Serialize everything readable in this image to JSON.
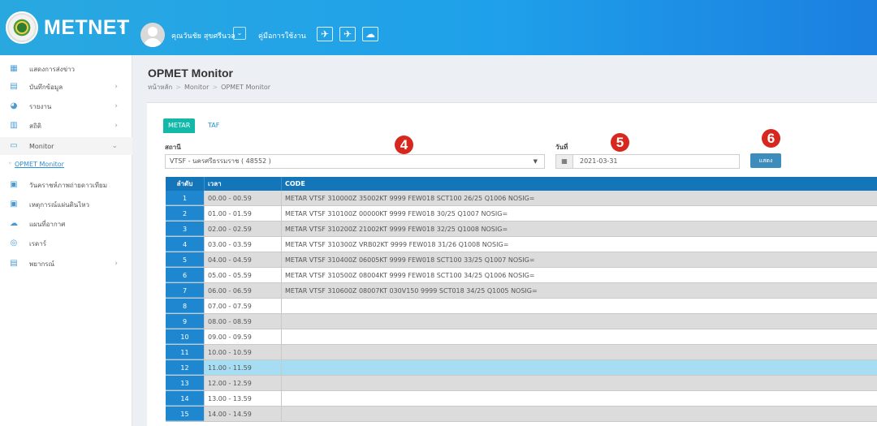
{
  "header": {
    "brand": "METNET",
    "collapse_icon": "chevron-left-icon",
    "username": "คุณวันชัย สุขศรีนวล",
    "user_caret": "⌄",
    "manual_link": "คู่มือการใช้งาน",
    "icons": [
      "plane-icon",
      "plane-icon",
      "cloud-icon"
    ]
  },
  "sidebar": {
    "items": [
      {
        "label": "แสดงการส่งข่าว",
        "icon": "grid-icon",
        "chevron": ""
      },
      {
        "label": "บันทึกข้อมูล",
        "icon": "document-icon",
        "chevron": "›"
      },
      {
        "label": "รายงาน",
        "icon": "pie-chart-icon",
        "chevron": "›"
      },
      {
        "label": "สถิติ",
        "icon": "bar-chart-icon",
        "chevron": "›"
      },
      {
        "label": "Monitor",
        "icon": "monitor-icon",
        "chevron": "⌄"
      },
      {
        "label": "วันคราชห์ภาพถ่ายดาวเทียม",
        "icon": "image-icon",
        "chevron": ""
      },
      {
        "label": "เหตุการณ์แผ่นดินไหว",
        "icon": "image-icon",
        "chevron": ""
      },
      {
        "label": "แผนที่อากาศ",
        "icon": "cloud-icon",
        "chevron": ""
      },
      {
        "label": "เรดาร์",
        "icon": "radar-icon",
        "chevron": ""
      },
      {
        "label": "พยากรณ์",
        "icon": "document-icon",
        "chevron": "›"
      }
    ],
    "submenu_active": "OPMET Monitor"
  },
  "page": {
    "title": "OPMET Monitor",
    "breadcrumb": [
      "หน้าหลัก",
      "Monitor",
      "OPMET Monitor"
    ]
  },
  "tabs": [
    "METAR",
    "TAF"
  ],
  "form": {
    "station_label": "สถานี",
    "station_value": "VTSF - นครศรีธรรมราช ( 48552 )",
    "date_label": "วันที่",
    "date_value": "2021-03-31",
    "show_button": "แสดง"
  },
  "markers": [
    "4",
    "5",
    "6"
  ],
  "table": {
    "headers": [
      "ลำดับ",
      "เวลา",
      "CODE"
    ],
    "rows": [
      {
        "no": "1",
        "time": "00.00 - 00.59",
        "code": "METAR VTSF 310000Z 35002KT 9999 FEW018 SCT100 26/25 Q1006 NOSIG="
      },
      {
        "no": "2",
        "time": "01.00 - 01.59",
        "code": "METAR VTSF 310100Z 00000KT 9999 FEW018 30/25 Q1007 NOSIG="
      },
      {
        "no": "3",
        "time": "02.00 - 02.59",
        "code": "METAR VTSF 310200Z 21002KT 9999 FEW018 32/25 Q1008 NOSIG="
      },
      {
        "no": "4",
        "time": "03.00 - 03.59",
        "code": "METAR VTSF 310300Z VRB02KT 9999 FEW018 31/26 Q1008 NOSIG="
      },
      {
        "no": "5",
        "time": "04.00 - 04.59",
        "code": "METAR VTSF 310400Z 06005KT 9999 FEW018 SCT100 33/25 Q1007 NOSIG="
      },
      {
        "no": "6",
        "time": "05.00 - 05.59",
        "code": "METAR VTSF 310500Z 08004KT 9999 FEW018 SCT100 34/25 Q1006 NOSIG="
      },
      {
        "no": "7",
        "time": "06.00 - 06.59",
        "code": "METAR VTSF 310600Z 08007KT 030V150 9999 SCT018 34/25 Q1005 NOSIG="
      },
      {
        "no": "8",
        "time": "07.00 - 07.59",
        "code": ""
      },
      {
        "no": "9",
        "time": "08.00 - 08.59",
        "code": ""
      },
      {
        "no": "10",
        "time": "09.00 - 09.59",
        "code": ""
      },
      {
        "no": "11",
        "time": "10.00 - 10.59",
        "code": ""
      },
      {
        "no": "12",
        "time": "11.00 - 11.59",
        "code": ""
      },
      {
        "no": "13",
        "time": "12.00 - 12.59",
        "code": ""
      },
      {
        "no": "14",
        "time": "13.00 - 13.59",
        "code": ""
      },
      {
        "no": "15",
        "time": "14.00 - 14.59",
        "code": ""
      }
    ]
  },
  "colors": {
    "header": "#1fa1ea",
    "table_header": "#1475b8",
    "index_cell": "#1e87cf",
    "tab_active": "#12b8a8",
    "highlight_row": "#a6ddf2",
    "marker": "#d6281f",
    "button": "#3c8dbc"
  }
}
